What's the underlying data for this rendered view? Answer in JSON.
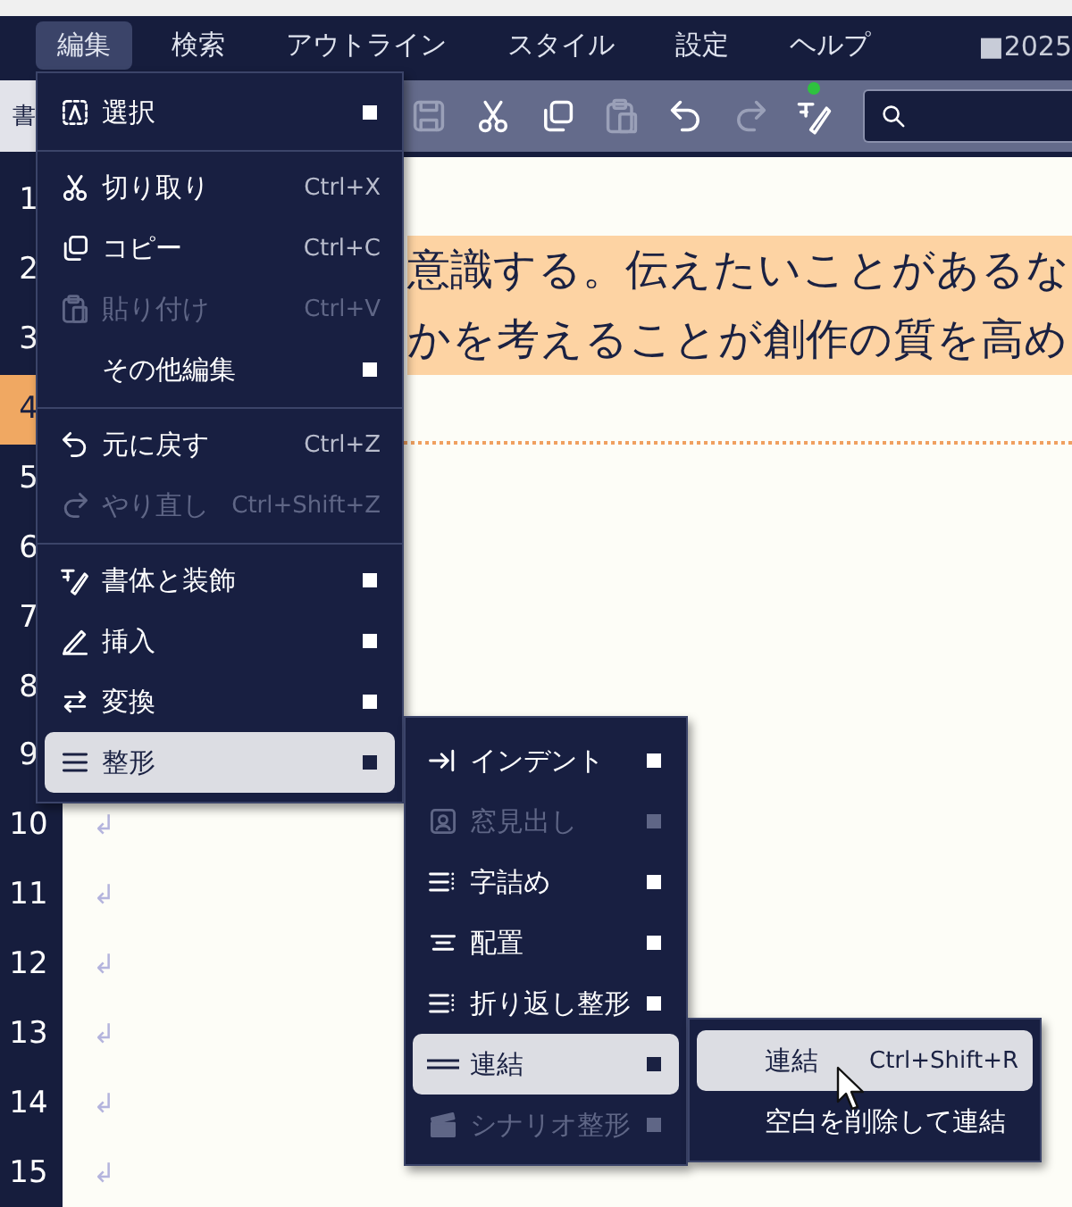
{
  "menubar": {
    "items": [
      {
        "label": "編集",
        "selected": true
      },
      {
        "label": "検索",
        "selected": false
      },
      {
        "label": "アウトライン",
        "selected": false
      },
      {
        "label": "スタイル",
        "selected": false
      },
      {
        "label": "設定",
        "selected": false
      },
      {
        "label": "ヘルプ",
        "selected": false
      }
    ],
    "status_fragment": "■2025"
  },
  "side_tab": {
    "label": "書"
  },
  "toolbar": {
    "buttons": [
      {
        "kind": "save",
        "disabled": true,
        "badge": false
      },
      {
        "kind": "cut",
        "disabled": false,
        "badge": false
      },
      {
        "kind": "copy",
        "disabled": false,
        "badge": false
      },
      {
        "kind": "paste",
        "disabled": true,
        "badge": false
      },
      {
        "kind": "undo",
        "disabled": false,
        "badge": false
      },
      {
        "kind": "redo",
        "disabled": true,
        "badge": false
      },
      {
        "kind": "font-style",
        "disabled": false,
        "badge": true
      }
    ]
  },
  "editor": {
    "lines": [
      {
        "number": "1",
        "current": false
      },
      {
        "number": "2",
        "current": false,
        "text": "意識する。伝えたいことがあるな",
        "highlighted": true
      },
      {
        "number": "3",
        "current": false,
        "text": "かを考えることが創作の質を高め",
        "highlighted": true
      },
      {
        "number": "4",
        "current": true
      },
      {
        "number": "5",
        "current": false
      },
      {
        "number": "6",
        "current": false
      },
      {
        "number": "7",
        "current": false
      },
      {
        "number": "8",
        "current": false
      },
      {
        "number": "9",
        "current": false
      },
      {
        "number": "10",
        "current": false,
        "return_mark": "↲"
      },
      {
        "number": "11",
        "current": false,
        "return_mark": "↲"
      },
      {
        "number": "12",
        "current": false,
        "return_mark": "↲"
      },
      {
        "number": "13",
        "current": false,
        "return_mark": "↲"
      },
      {
        "number": "14",
        "current": false,
        "return_mark": "↲"
      },
      {
        "number": "15",
        "current": false,
        "return_mark": "↲"
      }
    ]
  },
  "edit_menu": {
    "items": [
      {
        "kind": "select",
        "label": "選択",
        "submenu": true,
        "disabled": false,
        "selected": false
      },
      {
        "kind": "separator"
      },
      {
        "kind": "cut",
        "label": "切り取り",
        "shortcut": "Ctrl+X",
        "submenu": false,
        "disabled": false,
        "selected": false
      },
      {
        "kind": "copy",
        "label": "コピー",
        "shortcut": "Ctrl+C",
        "submenu": false,
        "disabled": false,
        "selected": false
      },
      {
        "kind": "paste",
        "label": "貼り付け",
        "shortcut": "Ctrl+V",
        "submenu": false,
        "disabled": true,
        "selected": false
      },
      {
        "kind": "plain",
        "label": "その他編集",
        "submenu": true,
        "disabled": false,
        "selected": false
      },
      {
        "kind": "separator"
      },
      {
        "kind": "undo",
        "label": "元に戻す",
        "shortcut": "Ctrl+Z",
        "submenu": false,
        "disabled": false,
        "selected": false
      },
      {
        "kind": "redo",
        "label": "やり直し",
        "shortcut": "Ctrl+Shift+Z",
        "submenu": false,
        "disabled": true,
        "selected": false
      },
      {
        "kind": "separator"
      },
      {
        "kind": "font-style",
        "label": "書体と装飾",
        "submenu": true,
        "disabled": false,
        "selected": false
      },
      {
        "kind": "insert",
        "label": "挿入",
        "submenu": true,
        "disabled": false,
        "selected": false
      },
      {
        "kind": "convert",
        "label": "変換",
        "submenu": true,
        "disabled": false,
        "selected": false
      },
      {
        "kind": "format",
        "label": "整形",
        "submenu": true,
        "disabled": false,
        "selected": true
      }
    ]
  },
  "format_submenu": {
    "items": [
      {
        "kind": "indent",
        "label": "インデント",
        "submenu": true,
        "disabled": false,
        "selected": false
      },
      {
        "kind": "heading",
        "label": "窓見出し",
        "submenu": true,
        "disabled": true,
        "selected": false
      },
      {
        "kind": "kerning",
        "label": "字詰め",
        "submenu": true,
        "disabled": false,
        "selected": false
      },
      {
        "kind": "align",
        "label": "配置",
        "submenu": true,
        "disabled": false,
        "selected": false
      },
      {
        "kind": "kerning",
        "label": "折り返し整形",
        "submenu": true,
        "disabled": false,
        "selected": false
      },
      {
        "kind": "join",
        "label": "連結",
        "submenu": true,
        "disabled": false,
        "selected": true
      },
      {
        "kind": "scenario",
        "label": "シナリオ整形",
        "submenu": true,
        "disabled": true,
        "selected": false
      }
    ]
  },
  "join_submenu": {
    "items": [
      {
        "kind": "plain",
        "label": "連結",
        "shortcut": "Ctrl+Shift+R",
        "submenu": false,
        "disabled": false,
        "selected": true
      },
      {
        "kind": "plain",
        "label": "空白を削除して連結",
        "submenu": false,
        "disabled": false,
        "selected": false
      }
    ]
  }
}
